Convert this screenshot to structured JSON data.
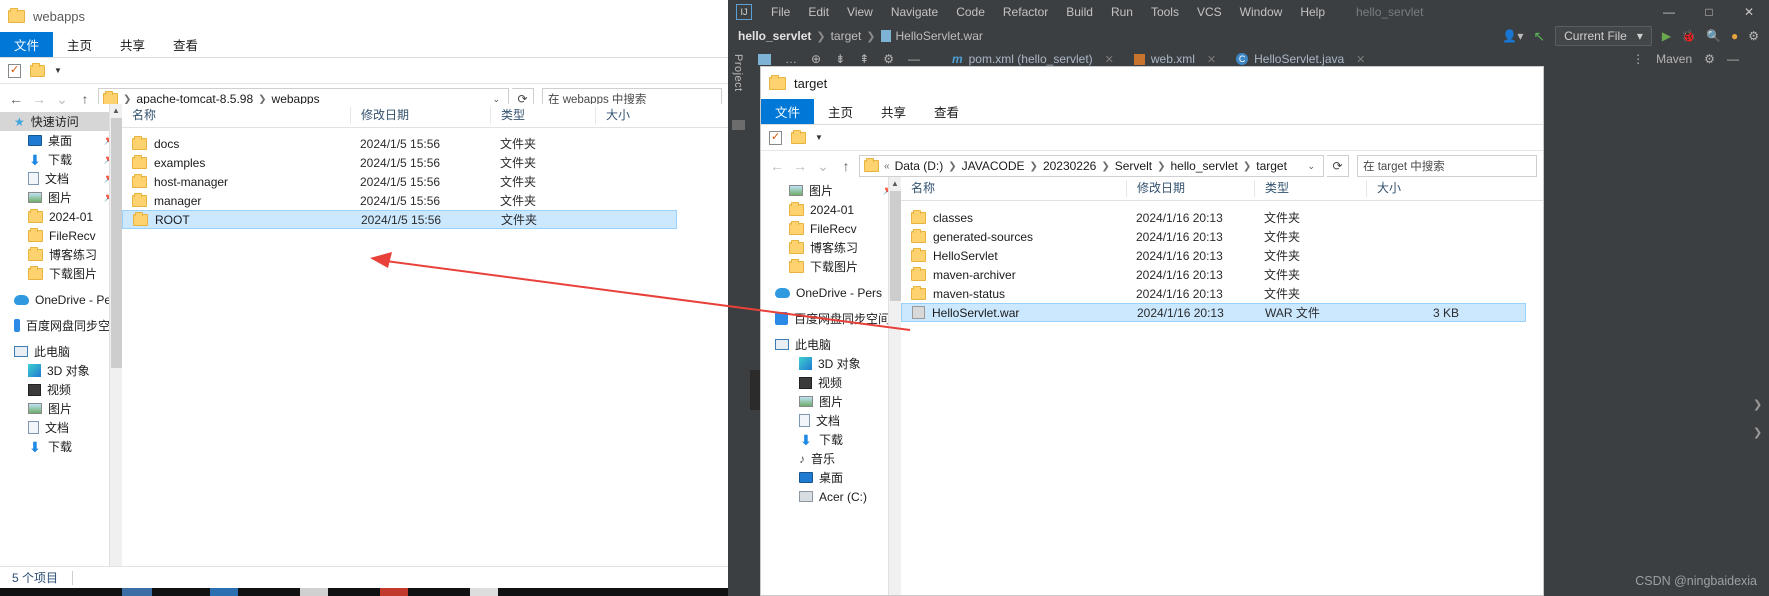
{
  "explorer1": {
    "title": "webapps",
    "ribbon_tabs": [
      "文件",
      "主页",
      "共享",
      "查看"
    ],
    "active_tab": "文件",
    "address": {
      "crumbs": [
        "apache-tomcat-8.5.98",
        "webapps"
      ],
      "search_placeholder": "在 webapps 中搜索"
    },
    "nav": {
      "quick_access": "快速访问",
      "pinned": [
        {
          "label": "桌面",
          "icon": "desktop-icon",
          "pinned": true
        },
        {
          "label": "下载",
          "icon": "download-icon",
          "pinned": true
        },
        {
          "label": "文档",
          "icon": "document-icon",
          "pinned": true
        },
        {
          "label": "图片",
          "icon": "pictures-icon",
          "pinned": true
        },
        {
          "label": "2024-01",
          "icon": "folder-icon",
          "pinned": false
        },
        {
          "label": "FileRecv",
          "icon": "folder-icon",
          "pinned": false
        },
        {
          "label": "博客练习",
          "icon": "folder-icon",
          "pinned": false
        },
        {
          "label": "下载图片",
          "icon": "folder-icon",
          "pinned": false
        }
      ],
      "onedrive": "OneDrive - Pers",
      "baidu": "百度网盘同步空间",
      "this_pc": "此电脑",
      "pc_children": [
        "3D 对象",
        "视频",
        "图片",
        "文档",
        "下载"
      ]
    },
    "columns": [
      "名称",
      "修改日期",
      "类型",
      "大小"
    ],
    "rows": [
      {
        "name": "docs",
        "date": "2024/1/5 15:56",
        "type": "文件夹",
        "size": ""
      },
      {
        "name": "examples",
        "date": "2024/1/5 15:56",
        "type": "文件夹",
        "size": ""
      },
      {
        "name": "host-manager",
        "date": "2024/1/5 15:56",
        "type": "文件夹",
        "size": ""
      },
      {
        "name": "manager",
        "date": "2024/1/5 15:56",
        "type": "文件夹",
        "size": ""
      },
      {
        "name": "ROOT",
        "date": "2024/1/5 15:56",
        "type": "文件夹",
        "size": "",
        "selected": true
      }
    ],
    "status": "5 个项目"
  },
  "idea": {
    "logo": "intellij-idea-logo",
    "menus": [
      "File",
      "Edit",
      "View",
      "Navigate",
      "Code",
      "Refactor",
      "Build",
      "Run",
      "Tools",
      "VCS",
      "Window",
      "Help"
    ],
    "project_name": "hello_servlet",
    "window_controls": [
      "—",
      "□",
      "✕"
    ],
    "breadcrumbs": [
      "hello_servlet",
      "target",
      "HelloServlet.war"
    ],
    "run_config": "Current File",
    "editor_tabs": [
      {
        "label": "pom.xml (hello_servlet)",
        "icon": "maven-icon"
      },
      {
        "label": "web.xml",
        "icon": "xml-icon"
      },
      {
        "label": "HelloServlet.java",
        "icon": "java-class-icon"
      }
    ],
    "maven_label": "Maven",
    "project_tool_label": "Project",
    "tree_node": "target"
  },
  "explorer2": {
    "title": "target",
    "ribbon_tabs": [
      "文件",
      "主页",
      "共享",
      "查看"
    ],
    "active_tab": "文件",
    "address": {
      "crumbs": [
        "Data (D:)",
        "JAVACODE",
        "20230226",
        "Servelt",
        "hello_servlet",
        "target"
      ],
      "prefix": "«",
      "search_placeholder": "在 target 中搜索"
    },
    "nav": {
      "pictures": "图片",
      "items": [
        "2024-01",
        "FileRecv",
        "博客练习",
        "下载图片"
      ],
      "onedrive": "OneDrive - Pers",
      "baidu": "百度网盘同步空间",
      "this_pc": "此电脑",
      "pc_children": [
        "3D 对象",
        "视频",
        "图片",
        "文档",
        "下载",
        "音乐",
        "桌面",
        "Acer (C:)"
      ]
    },
    "columns": [
      "名称",
      "修改日期",
      "类型",
      "大小"
    ],
    "rows": [
      {
        "name": "classes",
        "date": "2024/1/16 20:13",
        "type": "文件夹",
        "size": ""
      },
      {
        "name": "generated-sources",
        "date": "2024/1/16 20:13",
        "type": "文件夹",
        "size": ""
      },
      {
        "name": "HelloServlet",
        "date": "2024/1/16 20:13",
        "type": "文件夹",
        "size": ""
      },
      {
        "name": "maven-archiver",
        "date": "2024/1/16 20:13",
        "type": "文件夹",
        "size": ""
      },
      {
        "name": "maven-status",
        "date": "2024/1/16 20:13",
        "type": "文件夹",
        "size": ""
      },
      {
        "name": "HelloServlet.war",
        "date": "2024/1/16 20:13",
        "type": "WAR 文件",
        "size": "3 KB",
        "selected": true,
        "icon": "war-file-icon"
      }
    ]
  },
  "annotation": {
    "arrow_color": "#e8413a",
    "arrow_name": "red-annotation-arrow"
  },
  "watermark": "CSDN @ningbaidexia"
}
